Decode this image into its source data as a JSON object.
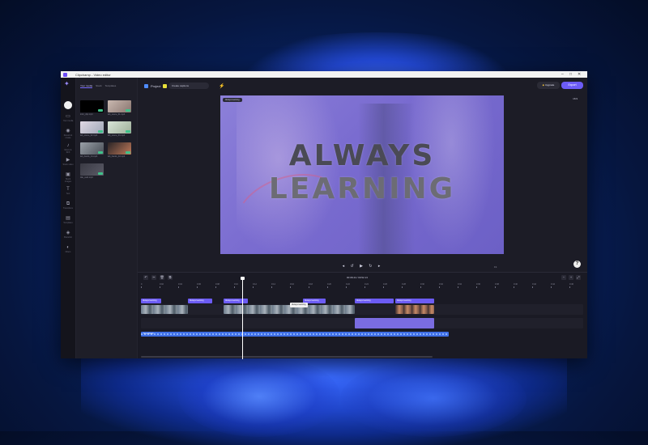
{
  "window": {
    "title": "Clipchamp - Video editor"
  },
  "library": {
    "tabs": [
      "Your media",
      "Stock",
      "Templates"
    ],
    "items": [
      {
        "caption": "intro_clip.mp4"
      },
      {
        "caption": "lab_scene_01.mp4"
      },
      {
        "caption": "lab_scene_02.mp4"
      },
      {
        "caption": "lab_scene_03.mp4"
      },
      {
        "caption": "lab_hands_01.mp4"
      },
      {
        "caption": "lab_hands_02.mp4"
      },
      {
        "caption": "title_card.mp4"
      }
    ]
  },
  "rail": {
    "items": [
      {
        "icon": "folder-icon",
        "label": "Your media"
      },
      {
        "icon": "record-icon",
        "label": "Record & create"
      },
      {
        "icon": "music-icon",
        "label": "Music & SFX"
      },
      {
        "icon": "video-icon",
        "label": "Stock video"
      },
      {
        "icon": "image-icon",
        "label": "Stock images"
      },
      {
        "icon": "text-icon",
        "label": "Text"
      },
      {
        "icon": "transitions-icon",
        "label": "Transitions"
      },
      {
        "icon": "templates-icon",
        "label": "Templates"
      },
      {
        "icon": "brand-icon",
        "label": "Brand kit"
      },
      {
        "icon": "filters-icon",
        "label": "Filters"
      }
    ]
  },
  "header": {
    "project_name": "Project",
    "chip_label": "Create captions",
    "upgrade_label": "Upgrade",
    "export_label": "Export",
    "ratio": "16:9"
  },
  "preview": {
    "tag": "Always learning",
    "headline_line1": "ALWAYS",
    "headline_line2": "LEARNING",
    "transport": "◂ ↺ ▶ ↻ ▸",
    "fit": "Fit"
  },
  "timeline": {
    "time_readout": "00:08.44 / 00:52.13",
    "ticks": [
      "0",
      "0:02",
      "0:04",
      "0:06",
      "0:08",
      "0:10",
      "0:12",
      "0:14",
      "0:16",
      "0:18",
      "0:20",
      "0:22",
      "0:24",
      "0:26",
      "0:28",
      "0:30",
      "0:32",
      "0:34",
      "0:36",
      "0:38",
      "0:40",
      "0:42",
      "0:44",
      "0:46"
    ],
    "text_clips": [
      "Always learning",
      "Always learning",
      "Always learning",
      "Always learning",
      "Always learning",
      "Always learning"
    ],
    "tooltip": "Always learning",
    "audio_label": "Soundtrack"
  },
  "colors": {
    "accent": "#6c5cf5",
    "background": "#1a1a24",
    "audio": "#3f6fe6"
  }
}
